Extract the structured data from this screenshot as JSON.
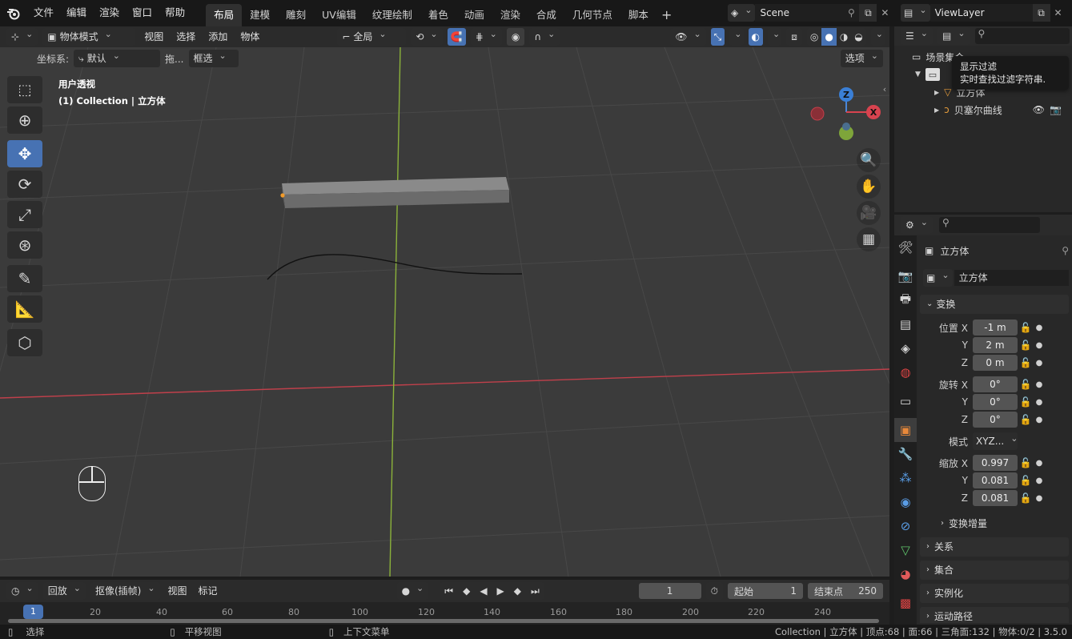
{
  "topbar": {
    "logo_icon": "blender-logo-icon",
    "menus": [
      "文件",
      "编辑",
      "渲染",
      "窗口",
      "帮助"
    ],
    "workspaces": [
      "布局",
      "建模",
      "雕刻",
      "UV编辑",
      "纹理绘制",
      "着色",
      "动画",
      "渲染",
      "合成",
      "几何节点",
      "脚本"
    ],
    "active_workspace": "布局",
    "add_tab": "+",
    "scene_name": "Scene",
    "view_layer": "ViewLayer"
  },
  "viewport_header": {
    "mode": "物体模式",
    "menus": [
      "视图",
      "选择",
      "添加",
      "物体"
    ],
    "transform_orientation": "全局",
    "coord_label": "坐标系:",
    "coord_value": "默认",
    "drag_label": "拖...",
    "drag_value": "框选",
    "options": "选项"
  },
  "viewport": {
    "view_name": "用户透视",
    "collection_info": "(1) Collection | 立方体",
    "gizmo_axes": [
      "Z",
      "X",
      "Y"
    ],
    "colors": {
      "background": "#3b3b3b",
      "x_axis": "#c0404b",
      "y_axis": "#8bb23a",
      "selection": "#4772b3"
    }
  },
  "outliner": {
    "scene_collection": "场景集合",
    "items": [
      "立方体",
      "贝塞尔曲线"
    ],
    "tooltip_title": "显示过滤",
    "tooltip_body": "实时查找过滤字符串."
  },
  "properties": {
    "object_name": "立方体",
    "datablock_name": "立方体",
    "transform_panel": "变换",
    "location": {
      "label": "位置",
      "x": "-1 m",
      "y": "2 m",
      "z": "0 m"
    },
    "rotation": {
      "label": "旋转",
      "x": "0°",
      "y": "0°",
      "z": "0°"
    },
    "mode_label": "模式",
    "mode_value": "XYZ...",
    "scale": {
      "label": "缩放",
      "x": "0.997",
      "y": "0.081",
      "z": "0.081"
    },
    "axis_labels": [
      "X",
      "Y",
      "Z"
    ],
    "delta_transform": "变换增量",
    "panels": [
      "关系",
      "集合",
      "实例化",
      "运动路径"
    ]
  },
  "timeline": {
    "playback": "回放",
    "keying": "抠像(插帧)",
    "view": "视图",
    "markers": "标记",
    "current_frame": "1",
    "start_label": "起始",
    "start_value": "1",
    "end_label": "结束点",
    "end_value": "250",
    "ruler": [
      "1",
      "20",
      "40",
      "60",
      "80",
      "100",
      "120",
      "140",
      "160",
      "180",
      "200",
      "220",
      "240"
    ]
  },
  "statusbar": {
    "select": "选择",
    "pan": "平移视图",
    "context_menu": "上下文菜单",
    "stats": "Collection | 立方体 | 顶点:68 | 面:66 | 三角面:132 | 物体:0/2 | 3.5.0"
  }
}
